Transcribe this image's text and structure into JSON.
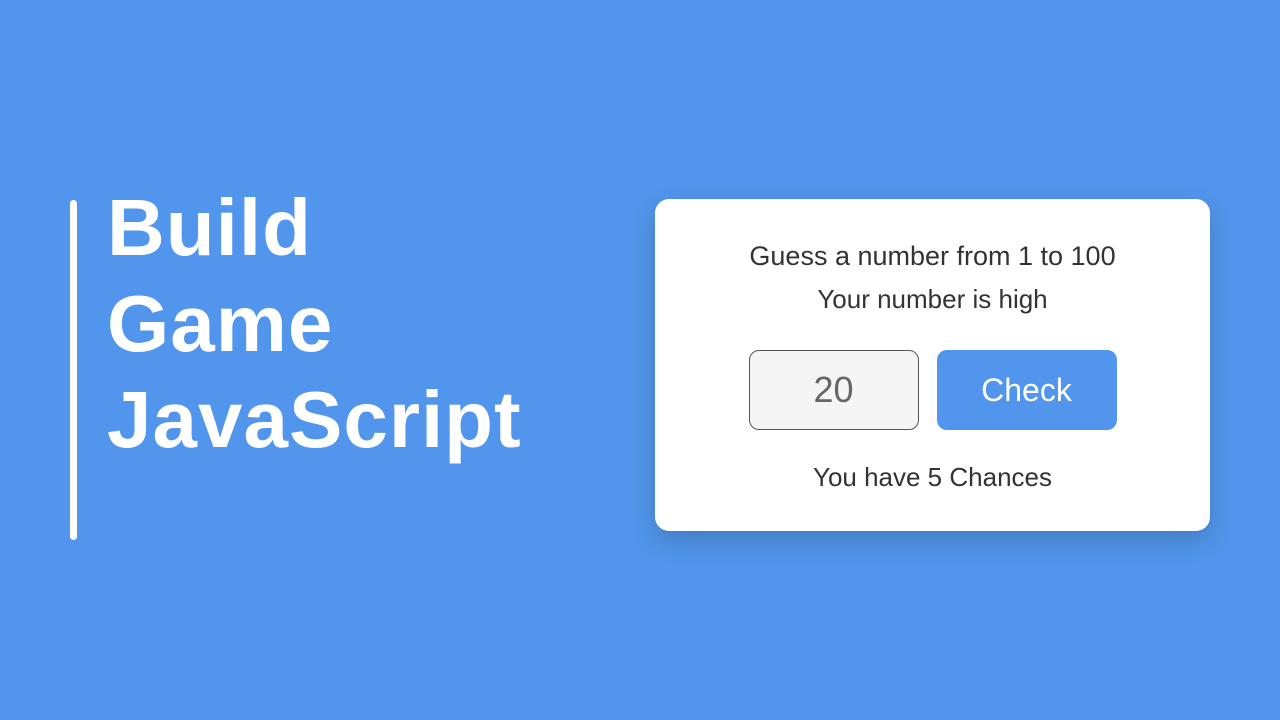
{
  "title": {
    "line1": "Build",
    "line2": "Game",
    "line3": "JavaScript"
  },
  "card": {
    "prompt": "Guess a number from 1 to 100",
    "feedback": "Your number is high",
    "input_value": "20",
    "check_label": "Check",
    "chances": "You have 5 Chances"
  }
}
